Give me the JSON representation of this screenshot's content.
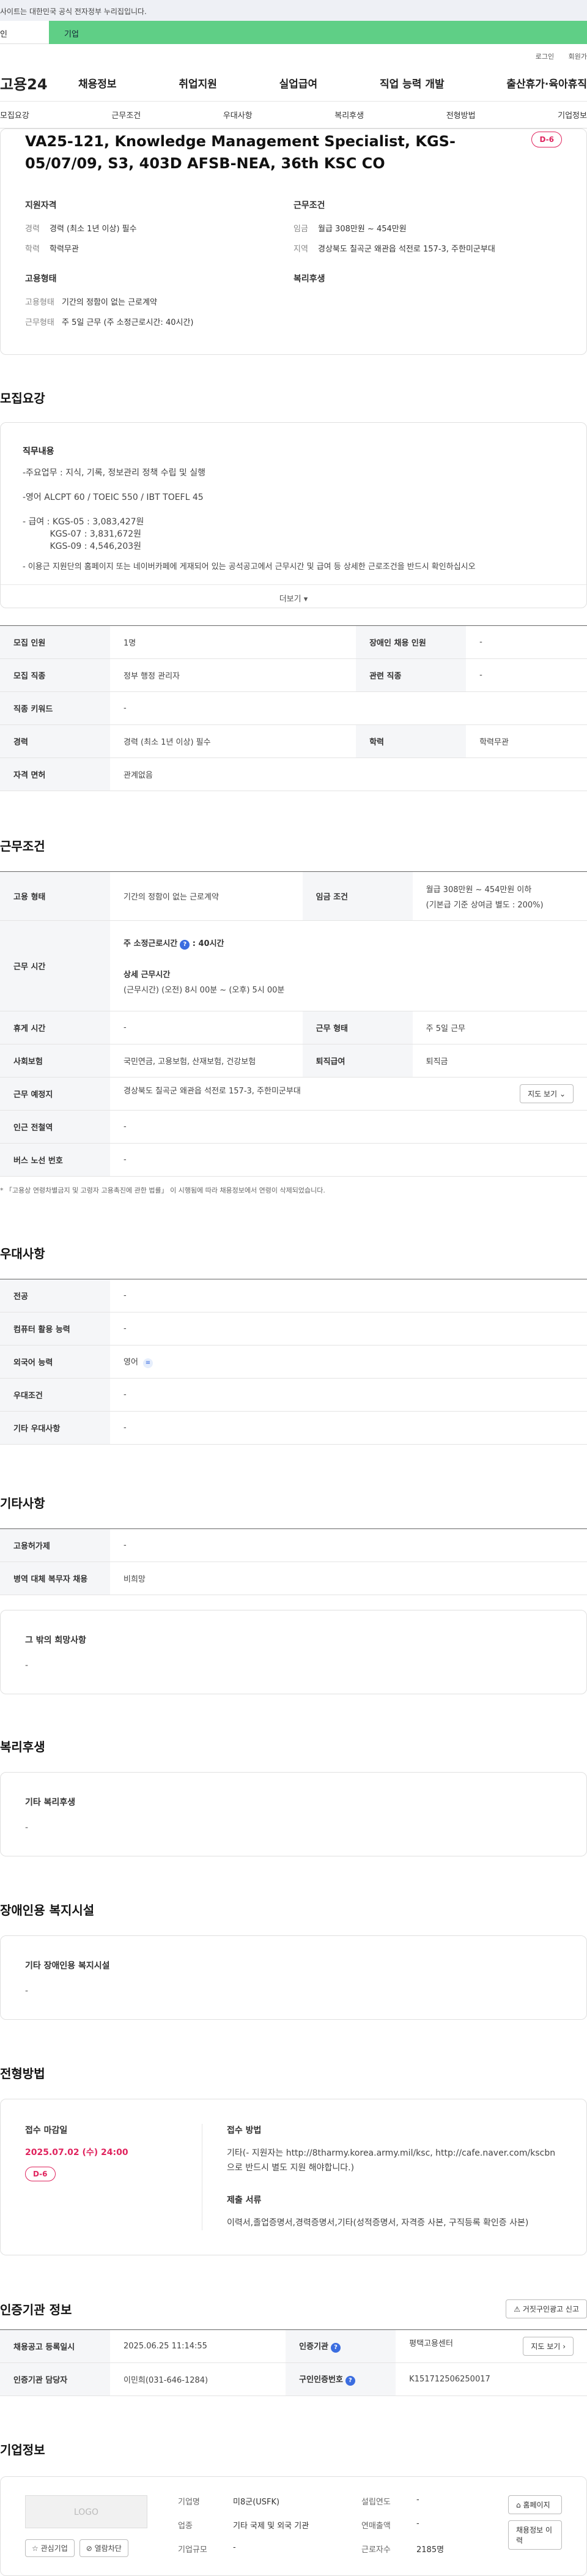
{
  "gov_banner": "사이트는 대한민국 공식 전자정부 누리집입니다.",
  "top_tabs": [
    "인",
    "기업"
  ],
  "util": [
    "로그인",
    "회원가"
  ],
  "logo": "고용24",
  "gnb": [
    "채용정보",
    "취업지원",
    "실업급여",
    "직업 능력 개발",
    "출산휴가·육아휴직"
  ],
  "tabs": [
    "모집요강",
    "근무조건",
    "우대사항",
    "복리후생",
    "전형방법",
    "기업정보"
  ],
  "summary": {
    "title": "VA25-121, Knowledge Management Specialist, KGS-05/07/09, S3, 403D AFSB-NEA, 36th KSC CO",
    "dday": "D-6",
    "qual_title": "지원자격",
    "qual": [
      {
        "k": "경력",
        "v": "경력 (최소 1년 이상) 필수"
      },
      {
        "k": "학력",
        "v": "학력무관"
      }
    ],
    "emp_title": "고용형태",
    "emp": [
      {
        "k": "고용형태",
        "v": "기간의 정함이 없는 근로계약"
      },
      {
        "k": "근무형태",
        "v": "주 5일 근무 (주 소정근로시간: 40시간)"
      }
    ],
    "cond_title": "근무조건",
    "cond": [
      {
        "k": "임금",
        "v": "월급 308만원 ~ 454만원"
      },
      {
        "k": "지역",
        "v": "경상북도 칠곡군 왜관읍 석전로 157-3, 주한미군부대"
      }
    ],
    "welfare_title": "복리후생"
  },
  "recruit": {
    "title": "모집요강",
    "job_title": "직무내용",
    "lines": [
      "-주요업무 : 지식, 기록, 정보관리 정책 수립 및 실행",
      "-영어 ALCPT 60 /  TOEIC 550 / IBT TOEFL 45",
      "- 급여 : KGS-05 : 3,083,427원",
      "          KGS-07 : 3,831,672원",
      "          KGS-09 : 4,546,203원",
      "- 이용근 지원단의 홈페이지 또는 네이버카페에 게재되어 있는 공석공고에서 근무시간 및 급여 등 상세한 근로조건을 반드시 확인하십시오"
    ],
    "more": "더보기",
    "table": [
      [
        "모집 인원",
        "1명",
        "장애인 채용 인원",
        "-"
      ],
      [
        "모집 직종",
        "정부 행정 관리자",
        "관련 직종",
        "-"
      ],
      [
        "직종 키워드",
        "-"
      ],
      [
        "경력",
        "경력 (최소 1년 이상) 필수",
        "학력",
        "학력무관"
      ],
      [
        "자격 면허",
        "관계없음"
      ]
    ]
  },
  "work": {
    "title": "근무조건",
    "emp_type_k": "고용 형태",
    "emp_type_v": "기간의 정함이 없는 근로계약",
    "wage_k": "임금 조건",
    "wage_v1": "월급 308만원 ~ 454만원 이하",
    "wage_v2": "(기본급 기준 상여금 별도 : 200%)",
    "hours_k": "근무 시간",
    "hours_v1": "주 소정근로시간",
    "hours_v1b": ": 40시간",
    "hours_v2": "상세 근무시간",
    "hours_v3": "(근무시간) (오전) 8시 00분 ~ (오후) 5시 00분",
    "rest_k": "휴게 시간",
    "rest_v": "-",
    "form_k": "근무 형태",
    "form_v": "주 5일 근무",
    "ins_k": "사회보험",
    "ins_v": "국민연금, 고용보험, 산재보험, 건강보험",
    "ret_k": "퇴직급여",
    "ret_v": "퇴직금",
    "loc_k": "근무 예정지",
    "loc_v": "경상북도 칠곡군 왜관읍 석전로 157-3, 주한미군부대",
    "map_btn": "지도 보기",
    "sub_k": "인근 전철역",
    "sub_v": "-",
    "bus_k": "버스 노선 번호",
    "bus_v": "-",
    "note": "* 「고용상 연령차별금지 및 고령자 고용촉진에 관한 법률」 이 시행됨에 따라 채용정보에서 연령이 삭제되었습니다."
  },
  "pref": {
    "title": "우대사항",
    "rows": [
      [
        "전공",
        "-"
      ],
      [
        "컴퓨터 활용 능력",
        "-"
      ],
      [
        "외국어 능력",
        "영어"
      ],
      [
        "우대조건",
        "-"
      ],
      [
        "기타 우대사항",
        "-"
      ]
    ]
  },
  "etc": {
    "title": "기타사항",
    "rows": [
      [
        "고용허가제",
        "-"
      ],
      [
        "병역 대체 복무자 채용",
        "비희망"
      ]
    ],
    "other_h": "그 밖의 희망사항",
    "other_v": "-"
  },
  "welfare": {
    "title": "복리후생",
    "h": "기타 복리후생",
    "v": "-"
  },
  "disabled": {
    "title": "장애인용 복지시설",
    "h": "기타 장애인용 복지시설",
    "v": "-"
  },
  "apply": {
    "title": "전형방법",
    "deadline_h": "접수 마감일",
    "deadline": "2025.07.02 (수) 24:00",
    "dday": "D-6",
    "method_h": "접수 방법",
    "method_v": "기타(- 지원자는 http://8tharmy.korea.army.mil/ksc, http://cafe.naver.com/kscbn 으로 반드시 별도 지원 해야합니다.)",
    "docs_h": "제출 서류",
    "docs_v": "이력서,졸업증명서,경력증명서,기타(성적증명서, 자격증 사본, 구직등록 확인증 사본)"
  },
  "cert": {
    "title": "인증기관 정보",
    "report_btn": "거짓구인광고 신고",
    "reg_k": "채용공고 등록일시",
    "reg_v": "2025.06.25 11:14:55",
    "org_k": "인증기관",
    "org_v": "평택고용센터",
    "map_btn": "지도 보기",
    "mgr_k": "인증기관 담당자",
    "mgr_v": "이민희(031-646-1284)",
    "no_k": "구인인증번호",
    "no_v": "K151712506250017"
  },
  "company": {
    "title": "기업정보",
    "logo": "LOGO",
    "fav_btn": "관심기업",
    "block_btn": "열람차단",
    "rows": [
      [
        "기업명",
        "미8군(USFK)",
        "설립연도",
        "-"
      ],
      [
        "업종",
        "기타 국제 및 외국 기관",
        "연매출액",
        "-"
      ],
      [
        "기업규모",
        "-",
        "근로자수",
        "2185명"
      ]
    ],
    "home_btn": "홈페이지",
    "jobs_btn": "채용정보 이력"
  }
}
